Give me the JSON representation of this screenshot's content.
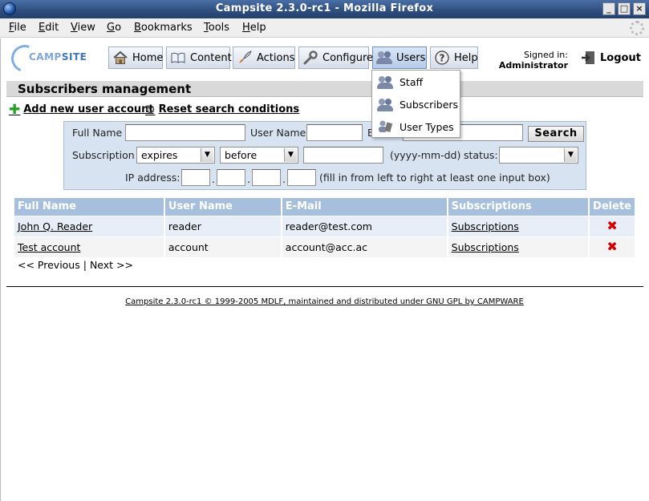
{
  "window": {
    "title": "Campsite 2.3.0-rc1 - Mozilla Firefox",
    "buttons": [
      "_",
      "□",
      "×"
    ]
  },
  "menubar": {
    "items": [
      {
        "label": "File",
        "u": "F",
        "rest": "ile"
      },
      {
        "label": "Edit",
        "u": "E",
        "rest": "dit"
      },
      {
        "label": "View",
        "u": "V",
        "rest": "iew"
      },
      {
        "label": "Go",
        "u": "G",
        "rest": "o"
      },
      {
        "label": "Bookmarks",
        "u": "B",
        "rest": "ookmarks"
      },
      {
        "label": "Tools",
        "u": "T",
        "rest": "ools"
      },
      {
        "label": "Help",
        "u": "H",
        "rest": "elp"
      }
    ]
  },
  "logo": {
    "text_light": "CAMP",
    "text_bold": "SITE"
  },
  "nav": {
    "home": "Home",
    "content": "Content",
    "actions": "Actions",
    "configure": "Configure",
    "users": "Users",
    "help": "Help"
  },
  "account": {
    "signed_in_label": "Signed in:",
    "user": "Administrator",
    "logout": "Logout"
  },
  "users_menu": {
    "items": [
      "Staff",
      "Subscribers",
      "User Types"
    ]
  },
  "section": {
    "title": "Subscribers management"
  },
  "actions": {
    "add_new": "Add new user account",
    "reset_search": "Reset search conditions"
  },
  "search": {
    "full_name_label": "Full Name",
    "user_name_label": "User Name",
    "email_label_partial": "E",
    "search_button": "Search",
    "subscription_label": "Subscription",
    "subscription_field_value": "expires",
    "subscription_cond_value": "before",
    "date_hint": "(yyyy-mm-dd)",
    "status_label": "status:",
    "status_value": "",
    "ip_label": "IP address:",
    "ip_hint": "(fill in from left to right at least one input box)",
    "ip_dot": "."
  },
  "table": {
    "headers": [
      "Full Name",
      "User Name",
      "E-Mail",
      "Subscriptions",
      "Delete"
    ],
    "rows": [
      {
        "full_name": "John Q. Reader",
        "user_name": "reader",
        "email": "reader@test.com",
        "subscriptions": "Subscriptions",
        "delete": "✖"
      },
      {
        "full_name": "Test account",
        "user_name": "account",
        "email": "account@acc.ac",
        "subscriptions": "Subscriptions",
        "delete": "✖"
      }
    ]
  },
  "pager": {
    "previous": "<< Previous",
    "sep": "|",
    "next": "Next >>"
  },
  "footer": {
    "text": "Campsite 2.3.0-rc1 © 1999-2005 MDLF, maintained and distributed under GNU GPL by CAMPWARE"
  }
}
